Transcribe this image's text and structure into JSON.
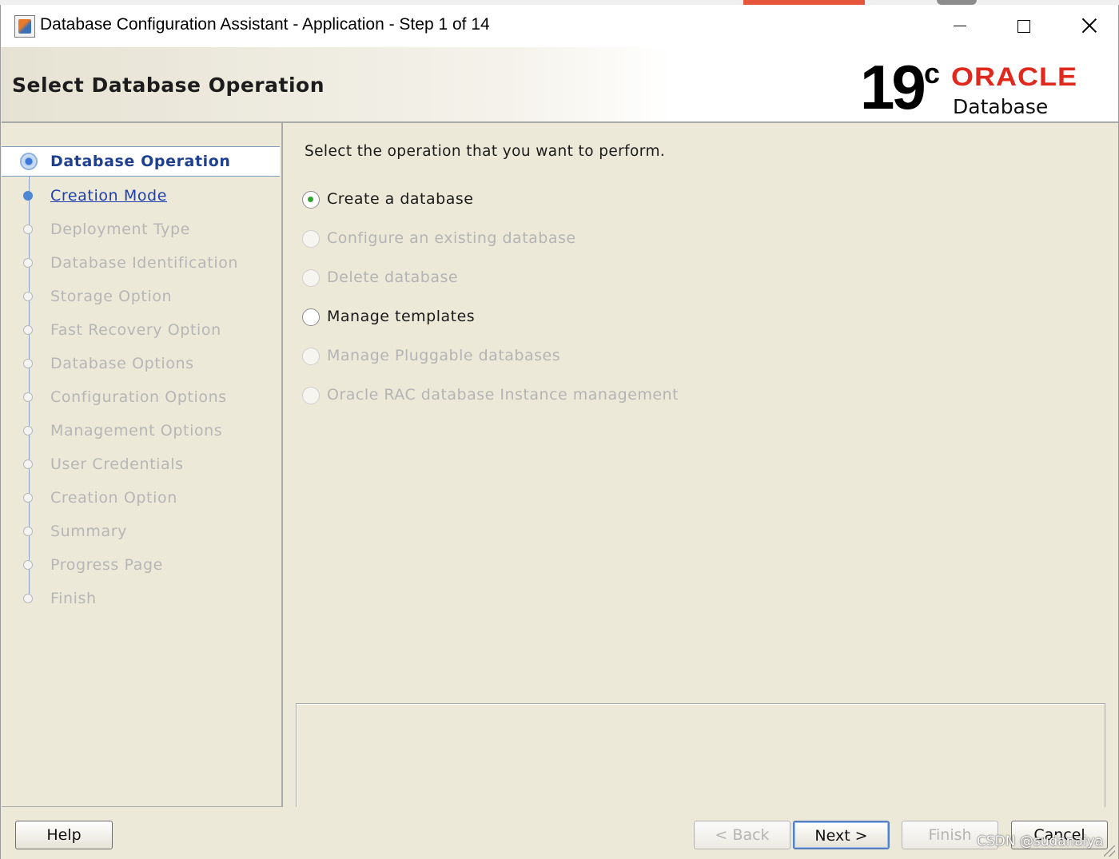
{
  "window": {
    "title": "Database Configuration Assistant - Application - Step 1 of 14",
    "buttons": [
      "minimize",
      "maximize",
      "close"
    ]
  },
  "header": {
    "title": "Select Database Operation",
    "logo": {
      "version": "19",
      "superscript": "c",
      "brand": "ORACLE",
      "product": "Database"
    }
  },
  "nav": {
    "steps": [
      {
        "label": "Database Operation",
        "state": "current"
      },
      {
        "label": "Creation Mode",
        "state": "done"
      },
      {
        "label": "Deployment Type",
        "state": "disabled"
      },
      {
        "label": "Database Identification",
        "state": "disabled"
      },
      {
        "label": "Storage Option",
        "state": "disabled"
      },
      {
        "label": "Fast Recovery Option",
        "state": "disabled"
      },
      {
        "label": "Database Options",
        "state": "disabled"
      },
      {
        "label": "Configuration Options",
        "state": "disabled"
      },
      {
        "label": "Management Options",
        "state": "disabled"
      },
      {
        "label": "User Credentials",
        "state": "disabled"
      },
      {
        "label": "Creation Option",
        "state": "disabled"
      },
      {
        "label": "Summary",
        "state": "disabled"
      },
      {
        "label": "Progress Page",
        "state": "disabled"
      },
      {
        "label": "Finish",
        "state": "disabled"
      }
    ]
  },
  "main": {
    "instruction": "Select the operation that you want to perform.",
    "options": [
      {
        "label": "Create a database",
        "selected": true,
        "enabled": true
      },
      {
        "label": "Configure an existing database",
        "selected": false,
        "enabled": false
      },
      {
        "label": "Delete database",
        "selected": false,
        "enabled": false
      },
      {
        "label": "Manage templates",
        "selected": false,
        "enabled": true
      },
      {
        "label": "Manage Pluggable databases",
        "selected": false,
        "enabled": false
      },
      {
        "label": "Oracle RAC database Instance management",
        "selected": false,
        "enabled": false
      }
    ],
    "description": ""
  },
  "footer": {
    "help": "Help",
    "back": "< Back",
    "next": "Next >",
    "finish": "Finish",
    "cancel": "Cancel"
  },
  "watermark": "CSDN @sudanaiya",
  "colors": {
    "oracle_red": "#e0281d",
    "nav_link": "#1f3fae",
    "selected_radio": "#2ea52e",
    "panel_bg": "#ece9d8"
  }
}
